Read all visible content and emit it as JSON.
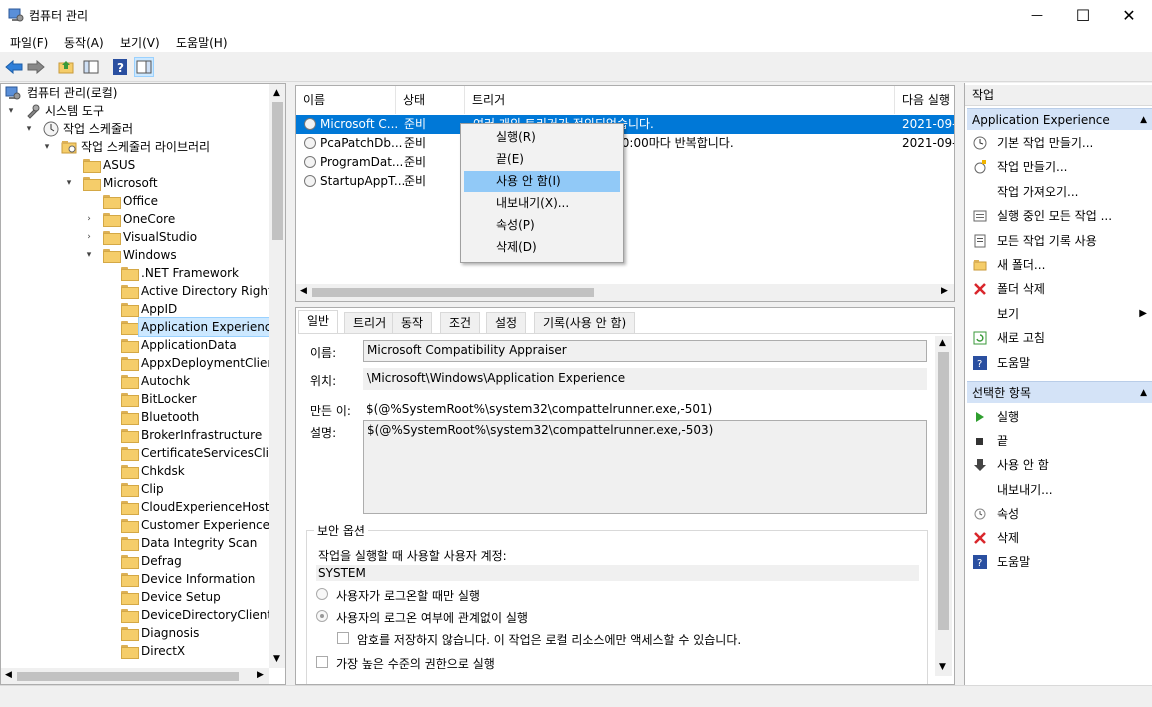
{
  "window": {
    "title": "컴퓨터 관리",
    "minimize": "—",
    "maximize": "☐",
    "close": "✕"
  },
  "menu": [
    "파일(F)",
    "동작(A)",
    "보기(V)",
    "도움말(H)"
  ],
  "tree": [
    {
      "label": "컴퓨터 관리(로컬)"
    },
    {
      "label": "시스템 도구"
    },
    {
      "label": "작업 스케줄러"
    },
    {
      "label": "작업 스케줄러 라이브러리"
    },
    {
      "label": "ASUS"
    },
    {
      "label": "Microsoft"
    },
    {
      "label": "Office"
    },
    {
      "label": "OneCore"
    },
    {
      "label": "VisualStudio"
    },
    {
      "label": "Windows"
    },
    {
      "label": ".NET Framework"
    },
    {
      "label": "Active Directory Rights"
    },
    {
      "label": "AppID"
    },
    {
      "label": "Application Experience"
    },
    {
      "label": "ApplicationData"
    },
    {
      "label": "AppxDeploymentClient"
    },
    {
      "label": "Autochk"
    },
    {
      "label": "BitLocker"
    },
    {
      "label": "Bluetooth"
    },
    {
      "label": "BrokerInfrastructure"
    },
    {
      "label": "CertificateServicesClient"
    },
    {
      "label": "Chkdsk"
    },
    {
      "label": "Clip"
    },
    {
      "label": "CloudExperienceHost"
    },
    {
      "label": "Customer Experience Im"
    },
    {
      "label": "Data Integrity Scan"
    },
    {
      "label": "Defrag"
    },
    {
      "label": "Device Information"
    },
    {
      "label": "Device Setup"
    },
    {
      "label": "DeviceDirectoryClient"
    },
    {
      "label": "Diagnosis"
    },
    {
      "label": "DirectX"
    }
  ],
  "tasklist": {
    "columns": [
      "이름",
      "상태",
      "트리거",
      "다음 실행"
    ],
    "rows": [
      {
        "name": "Microsoft C...",
        "status": "준비",
        "trigger": "여러 개의 트리거가 정의되었습니다.",
        "next": "2021-09-"
      },
      {
        "name": "PcaPatchDb...",
        "status": "준비",
        "trigger": "트리거된 후 무기한으로 12:00:00마다 반복합니다.",
        "next": "2021-09-"
      },
      {
        "name": "ProgramDat...",
        "status": "준비",
        "trigger": "",
        "next": ""
      },
      {
        "name": "StartupAppT...",
        "status": "준비",
        "trigger": "",
        "next": ""
      }
    ]
  },
  "context_menu": [
    "실행(R)",
    "끝(E)",
    "사용 안 함(I)",
    "내보내기(X)...",
    "속성(P)",
    "삭제(D)"
  ],
  "detail": {
    "tabs": [
      "일반",
      "트리거",
      "동작",
      "조건",
      "설정",
      "기록(사용 안 함)"
    ],
    "name_label": "이름:",
    "name_value": "Microsoft Compatibility Appraiser",
    "location_label": "위치:",
    "location_value": "\\Microsoft\\Windows\\Application Experience",
    "author_label": "만든 이:",
    "author_value": "$(@%SystemRoot%\\system32\\compattelrunner.exe,-501)",
    "desc_label": "설명:",
    "desc_value": "$(@%SystemRoot%\\system32\\compattelrunner.exe,-503)",
    "security_title": "보안 옵션",
    "account_label": "작업을 실행할 때 사용할 사용자 계정:",
    "account_value": "SYSTEM",
    "radio1": "사용자가 로그온할 때만 실행",
    "radio2": "사용자의 로그온 여부에 관계없이 실행",
    "check_nosave": "암호를 저장하지 않습니다. 이 작업은 로컬 리소스에만 액세스할 수 있습니다.",
    "check_highest": "가장 높은 수준의 권한으로 실행"
  },
  "actions": {
    "header": "작업",
    "section1": "Application Experience",
    "items1": [
      "기본 작업 만들기...",
      "작업 만들기...",
      "작업 가져오기...",
      "실행 중인 모든 작업 ...",
      "모든 작업 기록 사용",
      "새 폴더...",
      "폴더 삭제",
      "보기",
      "새로 고침",
      "도움말"
    ],
    "section2": "선택한 항목",
    "items2": [
      "실행",
      "끝",
      "사용 안 함",
      "내보내기...",
      "속성",
      "삭제",
      "도움말"
    ]
  },
  "colors": {
    "selection": "#0078d7",
    "tree_selection": "#cce8ff",
    "section_header": "#d4e3f7",
    "menu_highlight": "#91c9f7"
  }
}
